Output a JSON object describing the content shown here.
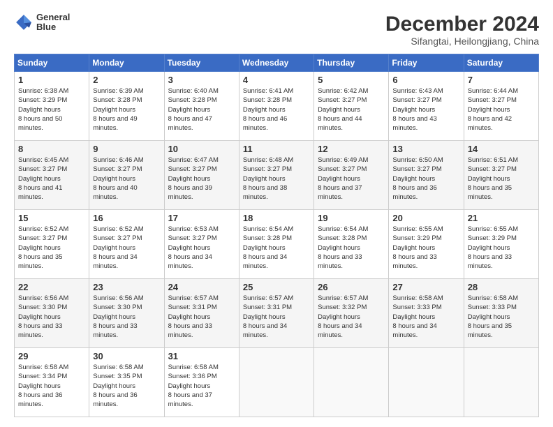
{
  "header": {
    "logo_line1": "General",
    "logo_line2": "Blue",
    "month": "December 2024",
    "location": "Sifangtai, Heilongjiang, China"
  },
  "days_of_week": [
    "Sunday",
    "Monday",
    "Tuesday",
    "Wednesday",
    "Thursday",
    "Friday",
    "Saturday"
  ],
  "weeks": [
    [
      {
        "day": "1",
        "sunrise": "6:38 AM",
        "sunset": "3:29 PM",
        "daylight": "8 hours and 50 minutes."
      },
      {
        "day": "2",
        "sunrise": "6:39 AM",
        "sunset": "3:28 PM",
        "daylight": "8 hours and 49 minutes."
      },
      {
        "day": "3",
        "sunrise": "6:40 AM",
        "sunset": "3:28 PM",
        "daylight": "8 hours and 47 minutes."
      },
      {
        "day": "4",
        "sunrise": "6:41 AM",
        "sunset": "3:28 PM",
        "daylight": "8 hours and 46 minutes."
      },
      {
        "day": "5",
        "sunrise": "6:42 AM",
        "sunset": "3:27 PM",
        "daylight": "8 hours and 44 minutes."
      },
      {
        "day": "6",
        "sunrise": "6:43 AM",
        "sunset": "3:27 PM",
        "daylight": "8 hours and 43 minutes."
      },
      {
        "day": "7",
        "sunrise": "6:44 AM",
        "sunset": "3:27 PM",
        "daylight": "8 hours and 42 minutes."
      }
    ],
    [
      {
        "day": "8",
        "sunrise": "6:45 AM",
        "sunset": "3:27 PM",
        "daylight": "8 hours and 41 minutes."
      },
      {
        "day": "9",
        "sunrise": "6:46 AM",
        "sunset": "3:27 PM",
        "daylight": "8 hours and 40 minutes."
      },
      {
        "day": "10",
        "sunrise": "6:47 AM",
        "sunset": "3:27 PM",
        "daylight": "8 hours and 39 minutes."
      },
      {
        "day": "11",
        "sunrise": "6:48 AM",
        "sunset": "3:27 PM",
        "daylight": "8 hours and 38 minutes."
      },
      {
        "day": "12",
        "sunrise": "6:49 AM",
        "sunset": "3:27 PM",
        "daylight": "8 hours and 37 minutes."
      },
      {
        "day": "13",
        "sunrise": "6:50 AM",
        "sunset": "3:27 PM",
        "daylight": "8 hours and 36 minutes."
      },
      {
        "day": "14",
        "sunrise": "6:51 AM",
        "sunset": "3:27 PM",
        "daylight": "8 hours and 35 minutes."
      }
    ],
    [
      {
        "day": "15",
        "sunrise": "6:52 AM",
        "sunset": "3:27 PM",
        "daylight": "8 hours and 35 minutes."
      },
      {
        "day": "16",
        "sunrise": "6:52 AM",
        "sunset": "3:27 PM",
        "daylight": "8 hours and 34 minutes."
      },
      {
        "day": "17",
        "sunrise": "6:53 AM",
        "sunset": "3:27 PM",
        "daylight": "8 hours and 34 minutes."
      },
      {
        "day": "18",
        "sunrise": "6:54 AM",
        "sunset": "3:28 PM",
        "daylight": "8 hours and 34 minutes."
      },
      {
        "day": "19",
        "sunrise": "6:54 AM",
        "sunset": "3:28 PM",
        "daylight": "8 hours and 33 minutes."
      },
      {
        "day": "20",
        "sunrise": "6:55 AM",
        "sunset": "3:29 PM",
        "daylight": "8 hours and 33 minutes."
      },
      {
        "day": "21",
        "sunrise": "6:55 AM",
        "sunset": "3:29 PM",
        "daylight": "8 hours and 33 minutes."
      }
    ],
    [
      {
        "day": "22",
        "sunrise": "6:56 AM",
        "sunset": "3:30 PM",
        "daylight": "8 hours and 33 minutes."
      },
      {
        "day": "23",
        "sunrise": "6:56 AM",
        "sunset": "3:30 PM",
        "daylight": "8 hours and 33 minutes."
      },
      {
        "day": "24",
        "sunrise": "6:57 AM",
        "sunset": "3:31 PM",
        "daylight": "8 hours and 33 minutes."
      },
      {
        "day": "25",
        "sunrise": "6:57 AM",
        "sunset": "3:31 PM",
        "daylight": "8 hours and 34 minutes."
      },
      {
        "day": "26",
        "sunrise": "6:57 AM",
        "sunset": "3:32 PM",
        "daylight": "8 hours and 34 minutes."
      },
      {
        "day": "27",
        "sunrise": "6:58 AM",
        "sunset": "3:33 PM",
        "daylight": "8 hours and 34 minutes."
      },
      {
        "day": "28",
        "sunrise": "6:58 AM",
        "sunset": "3:33 PM",
        "daylight": "8 hours and 35 minutes."
      }
    ],
    [
      {
        "day": "29",
        "sunrise": "6:58 AM",
        "sunset": "3:34 PM",
        "daylight": "8 hours and 36 minutes."
      },
      {
        "day": "30",
        "sunrise": "6:58 AM",
        "sunset": "3:35 PM",
        "daylight": "8 hours and 36 minutes."
      },
      {
        "day": "31",
        "sunrise": "6:58 AM",
        "sunset": "3:36 PM",
        "daylight": "8 hours and 37 minutes."
      },
      null,
      null,
      null,
      null
    ]
  ]
}
